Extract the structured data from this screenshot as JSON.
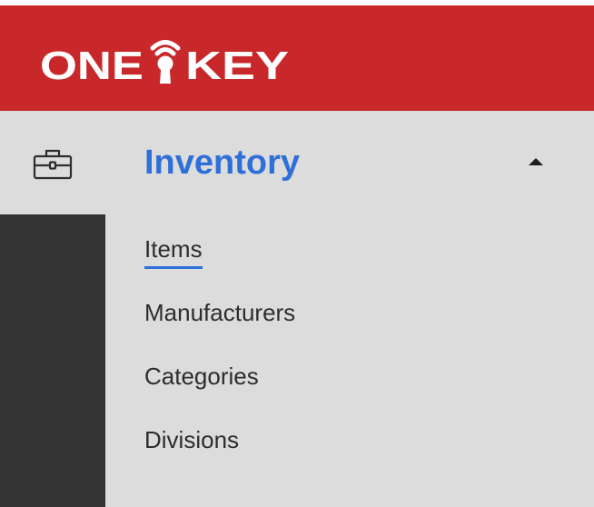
{
  "brand": {
    "logo_text": "ONE-KEY",
    "logo_icon": "onekey-logo",
    "colors": {
      "header_red": "#c8282a",
      "accent_blue": "#2f6fd8",
      "nav_bg": "#dcdcdc",
      "rail_dark": "#333333"
    }
  },
  "nav": {
    "section": {
      "icon": "toolbox-icon",
      "title": "Inventory",
      "expanded": true,
      "toggle_icon": "caret-up-icon"
    },
    "items": [
      {
        "label": "Items",
        "active": true
      },
      {
        "label": "Manufacturers",
        "active": false
      },
      {
        "label": "Categories",
        "active": false
      },
      {
        "label": "Divisions",
        "active": false
      }
    ]
  }
}
